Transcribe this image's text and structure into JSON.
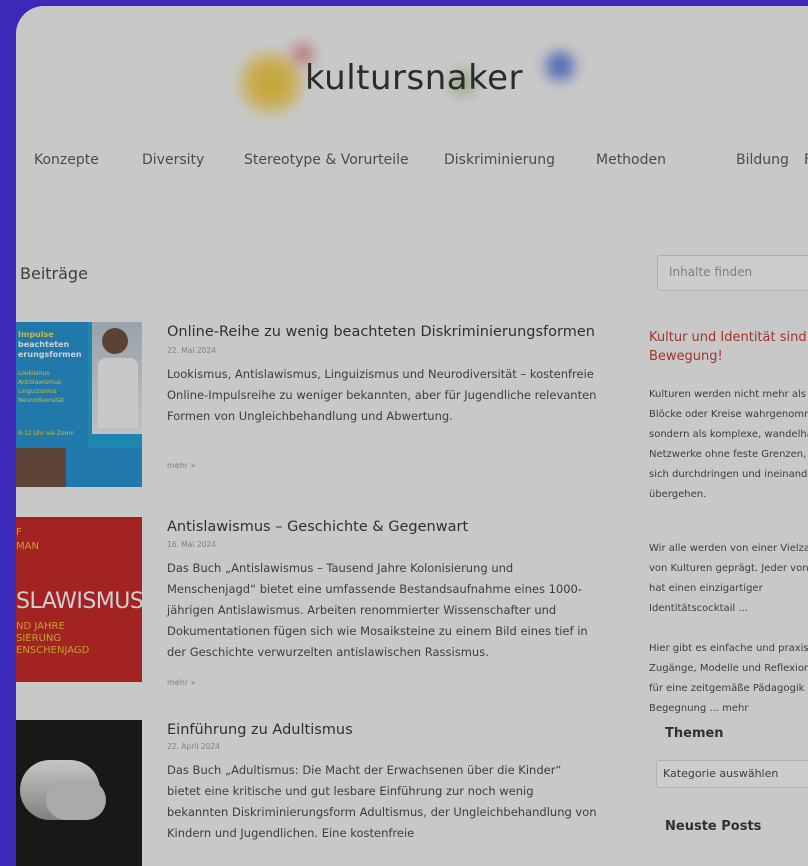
{
  "brand": {
    "name": "kultursnaker"
  },
  "nav": [
    "Konzepte",
    "Diversity",
    "Stereotype & Vorurteile",
    "Diskriminierung",
    "Methoden",
    "Bildung",
    "F"
  ],
  "main": {
    "section_title": "Beiträge",
    "posts": [
      {
        "title": "Online-Reihe zu wenig beachteten Diskriminierungsformen",
        "date": "22. Mai 2024",
        "excerpt": "Lookismus, Antislawismus, Linguizismus und Neurodiversität – kostenfreie Online-Impulsreihe zu weniger bekannten, aber für Jugendliche relevanten Formen von Ungleichbehandlung und Abwertung.",
        "more": "mehr »",
        "thumb_lines": [
          "Impulse",
          "beachteten",
          "erungsformen",
          "Lookismus",
          "Antislawismus",
          "Linguizismus",
          "Neurodiversität",
          "9-12 Uhr via Zoom"
        ]
      },
      {
        "title": "Antislawismus – Geschichte & Gegenwart",
        "date": "16. Mai 2024",
        "excerpt": "Das Buch „Antislawismus – Tausend Jahre Kolonisierung und Menschenjagd“ bietet eine umfassende Bestandsaufnahme eines 1000-jährigen Antislawismus. Arbeiten renommierter Wissenschafter und Dokumentationen fügen sich wie Mosaiksteine zu einem Bild eines tief in der Geschichte verwurzelten antislawischen Rassismus.",
        "more": "mehr »",
        "thumb_lines": [
          "F",
          "MAN",
          "SLAWISMUS",
          "ND JAHRE",
          "SIERUNG",
          "ENSCHENJAGD"
        ]
      },
      {
        "title": "Einführung zu Adultismus",
        "date": "22. April 2024",
        "excerpt": "Das Buch „Adultismus: Die Macht der Erwachsenen über die Kinder“ bietet eine kritische und gut lesbare Einführung zur noch wenig bekannten Diskriminierungsform Adultismus, der Ungleichbehandlung von Kindern und Jugendlichen. Eine kostenfreie",
        "more": "",
        "thumb_lines": []
      }
    ]
  },
  "sidebar": {
    "search_placeholder": "Inhalte finden",
    "heading": "Kultur und Identität sind in Bewegung!",
    "paragraphs": [
      "Kulturen werden nicht mehr als starre Blöcke oder Kreise wahrgenommen, sondern als komplexe, wandelhafte Netzwerke ohne feste Grenzen, die sich durchdringen und ineinander übergehen.",
      "Wir alle werden von einer Vielzahl von Kulturen geprägt. Jeder von uns hat einen einzigartiger Identitätscocktail ...",
      "Hier gibt es einfache und praxisnahe Zugänge, Modelle und Reflexionen für eine zeitgemäße Pädagogik der Begegnung ... mehr"
    ],
    "themen_title": "Themen",
    "category_select": "Kategorie auswählen",
    "neuste_title": "Neuste Posts"
  }
}
